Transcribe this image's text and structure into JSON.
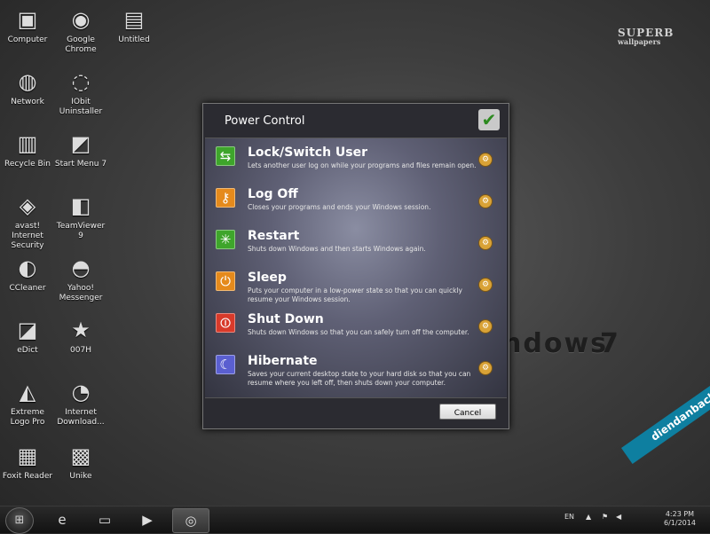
{
  "desktop": {
    "icons": [
      {
        "label": "Computer",
        "glyph": "▣"
      },
      {
        "label": "Google Chrome",
        "glyph": "◉"
      },
      {
        "label": "Untitled",
        "glyph": "▤"
      },
      {
        "label": "Network",
        "glyph": "◍"
      },
      {
        "label": "IObit Uninstaller",
        "glyph": "◌"
      },
      {
        "label": "Recycle Bin",
        "glyph": "▥"
      },
      {
        "label": "Start Menu 7",
        "glyph": "◩"
      },
      {
        "label": "avast! Internet Security",
        "glyph": "◈"
      },
      {
        "label": "TeamViewer 9",
        "glyph": "◧"
      },
      {
        "label": "CCleaner",
        "glyph": "◐"
      },
      {
        "label": "Yahoo! Messenger",
        "glyph": "◓"
      },
      {
        "label": "eDict",
        "glyph": "◪"
      },
      {
        "label": "007H",
        "glyph": "★"
      },
      {
        "label": "Extreme Logo Pro",
        "glyph": "◭"
      },
      {
        "label": "Internet Download...",
        "glyph": "◔"
      },
      {
        "label": "Foxit Reader",
        "glyph": "▦"
      },
      {
        "label": "Unike",
        "glyph": "▩"
      }
    ],
    "brand": {
      "line1": "SUPERB",
      "line2": "wallpapers"
    },
    "win_text": "ndows",
    "win_number": "7"
  },
  "dialog": {
    "title": "Power Control",
    "logo_icon": "✔",
    "options": [
      {
        "title": "Lock/Switch User",
        "desc": "Lets another user log on while your programs and files remain open.",
        "icon": "⇆",
        "color": "#3ea52b"
      },
      {
        "title": "Log Off",
        "desc": "Closes your programs and ends your Windows session.",
        "icon": "⚷",
        "color": "#e58a1c"
      },
      {
        "title": "Restart",
        "desc": "Shuts down Windows and then starts Windows again.",
        "icon": "✳",
        "color": "#3ea52b"
      },
      {
        "title": "Sleep",
        "desc": "Puts your computer in a low-power state so that you can quickly resume your Windows session.",
        "icon": "⏻",
        "color": "#e58a1c"
      },
      {
        "title": "Shut Down",
        "desc": "Shuts down Windows so that you can safely turn off the computer.",
        "icon": "⏼",
        "color": "#d83a2a"
      },
      {
        "title": "Hibernate",
        "desc": "Saves your current desktop state to your hard disk so that you can resume where you left off, then shuts down your computer.",
        "icon": "☾",
        "color": "#5a5fd0"
      }
    ],
    "pin_icon": "⚙",
    "cancel_label": "Cancel"
  },
  "taskbar": {
    "start_icon": "⊞",
    "buttons": [
      {
        "name": "internet-explorer",
        "icon": "e"
      },
      {
        "name": "file-explorer",
        "icon": "▭"
      },
      {
        "name": "media-player",
        "icon": "▶"
      },
      {
        "name": "chrome",
        "icon": "◎"
      }
    ],
    "language": "EN",
    "tray_up_icon": "▲",
    "flag_icon": "⚑",
    "volume_icon": "◀",
    "time": "4:23 PM",
    "date": "6/1/2014"
  },
  "banner": "diendanbaclieu.net"
}
